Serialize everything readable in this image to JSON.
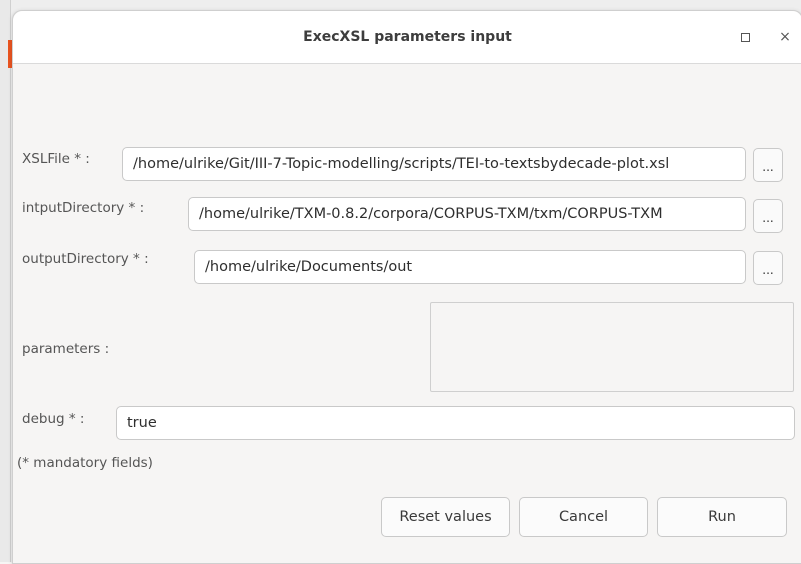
{
  "dialog": {
    "title": "ExecXSL parameters input",
    "maximize_glyph": "□",
    "close_glyph": "×"
  },
  "fields": {
    "xslfile": {
      "label": "XSLFile *",
      "value": "/home/ulrike/Git/III-7-Topic-modelling/scripts/TEI-to-textsbydecade-plot.xsl",
      "browse_label": "..."
    },
    "input_directory": {
      "label": "intputDirectory *",
      "value": "/home/ulrike/TXM-0.8.2/corpora/CORPUS-TXM/txm/CORPUS-TXM",
      "browse_label": "..."
    },
    "output_directory": {
      "label": "outputDirectory *",
      "value": "/home/ulrike/Documents/out",
      "browse_label": "..."
    },
    "parameters": {
      "label": "parameters",
      "value": ""
    },
    "debug": {
      "label": "debug *",
      "value": "true"
    }
  },
  "separator": " :",
  "mandatory_note": "(* mandatory fields)",
  "buttons": {
    "reset": "Reset values",
    "cancel": "Cancel",
    "run": "Run"
  },
  "colors": {
    "accent": "#e95420",
    "dialog_bg": "#f6f5f4",
    "titlebar_bg": "#ffffff"
  }
}
